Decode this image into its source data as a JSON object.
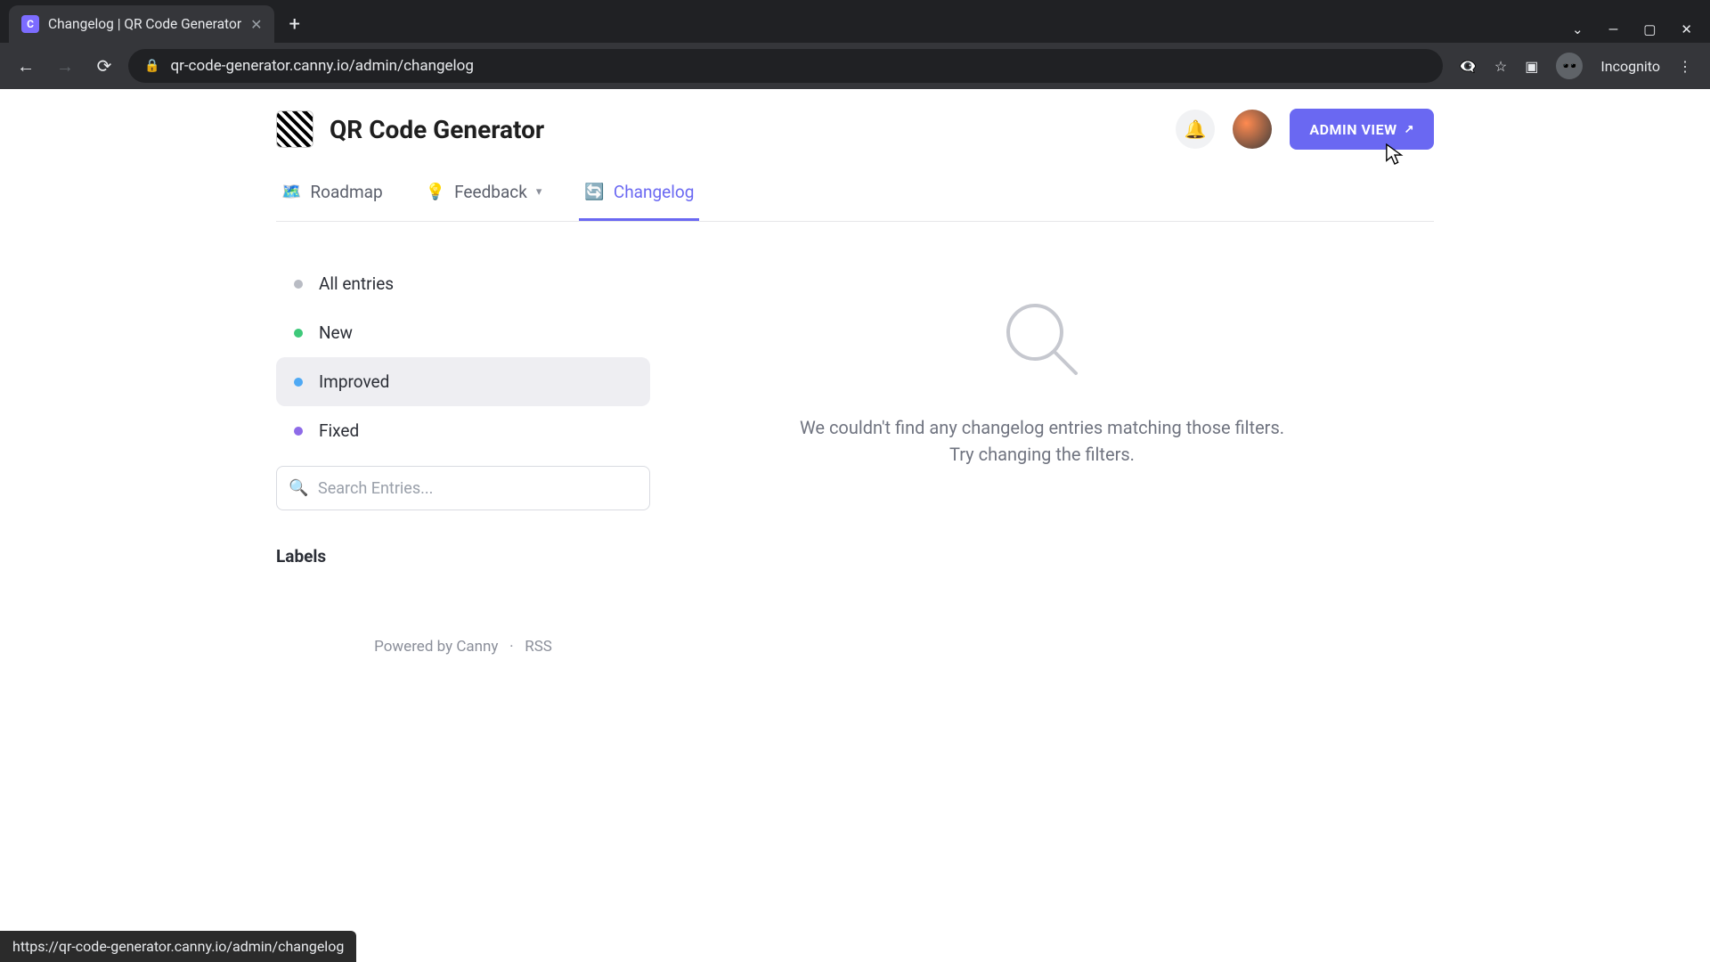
{
  "browser": {
    "tab_title": "Changelog | QR Code Generator",
    "url": "qr-code-generator.canny.io/admin/changelog",
    "incognito_label": "Incognito",
    "status_link": "https://qr-code-generator.canny.io/admin/changelog"
  },
  "header": {
    "app_name": "QR Code Generator",
    "admin_view_label": "ADMIN VIEW"
  },
  "tabs": {
    "roadmap": "Roadmap",
    "feedback": "Feedback",
    "changelog": "Changelog"
  },
  "filters": {
    "all": "All entries",
    "new": "New",
    "improved": "Improved",
    "fixed": "Fixed",
    "selected": "improved"
  },
  "search": {
    "placeholder": "Search Entries..."
  },
  "labels_title": "Labels",
  "footer": {
    "powered": "Powered by Canny",
    "separator": "·",
    "rss": "RSS"
  },
  "empty_state": {
    "line1": "We couldn't find any changelog entries matching those filters.",
    "line2": "Try changing the filters."
  }
}
